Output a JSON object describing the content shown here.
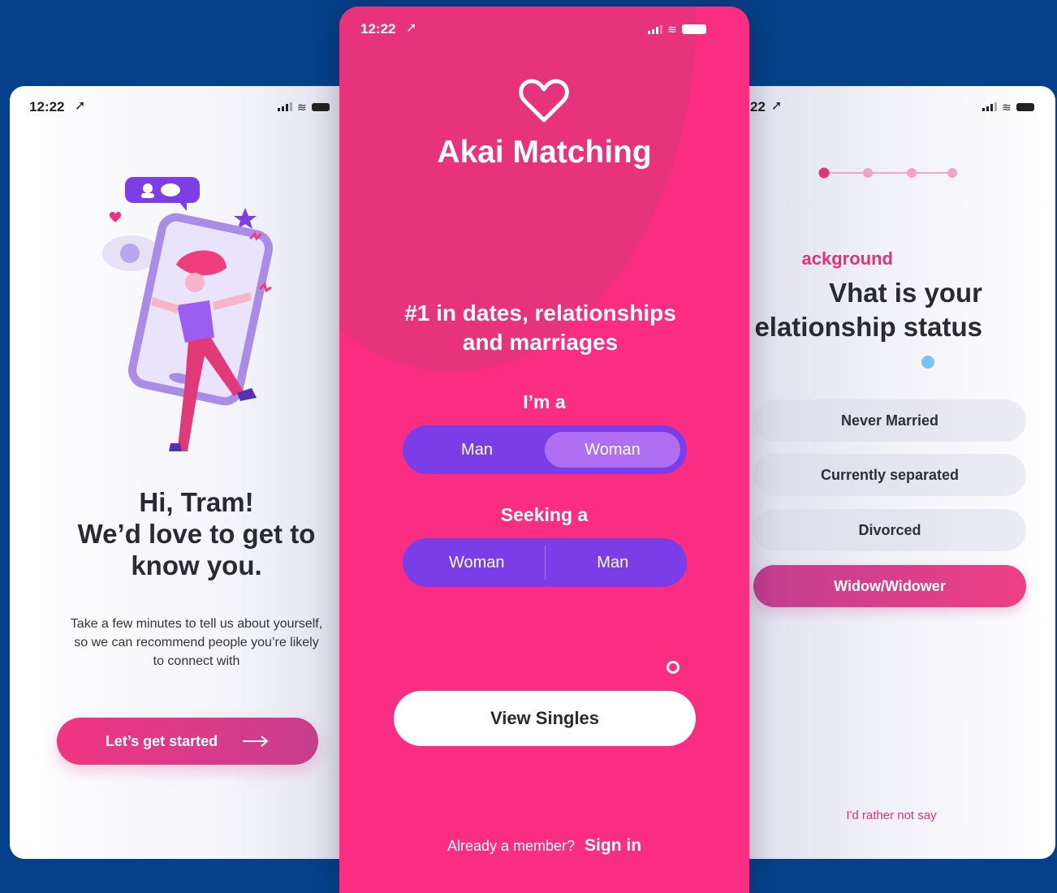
{
  "status_bar": {
    "time": "12:22"
  },
  "left_screen": {
    "greeting_line1": "Hi, Tram!",
    "greeting_line2": "We’d love to get to",
    "greeting_line3": "know you.",
    "description_line1": "Take a few minutes to tell us about yourself,",
    "description_line2": "so we can recommend people you’re likely",
    "description_line3": "to connect with",
    "cta_label": "Let’s get started",
    "cta_icon": "arrow-right-icon"
  },
  "center_screen": {
    "app_name": "Akai Matching",
    "logo_icon": "heart-outline-icon",
    "tagline_line1": "#1 in dates, relationships",
    "tagline_line2": "and marriages",
    "i_am_label": "I’m a",
    "i_am_options": [
      "Man",
      "Woman"
    ],
    "i_am_selected": "Woman",
    "seeking_label": "Seeking a",
    "seeking_options": [
      "Woman",
      "Man"
    ],
    "primary_button": "View Singles",
    "member_question": "Already a member?",
    "sign_in": "Sign in"
  },
  "right_screen": {
    "progress_total_steps": 4,
    "progress_current_step": 1,
    "section_label": "ackground",
    "question_line1": "Vhat is your",
    "question_line2": "elationship status",
    "options": [
      "Never Married",
      "Currently separated",
      "Divorced",
      "Widow/Widower"
    ],
    "selected_option": "Widow/Widower",
    "skip_label": "I'd rather not say",
    "time_visible": "22"
  },
  "colors": {
    "background": "#06408a",
    "brand_pink": "#fb2d83",
    "toggle_purple": "#7b3de8",
    "accent_pink_text": "#e0337a"
  }
}
